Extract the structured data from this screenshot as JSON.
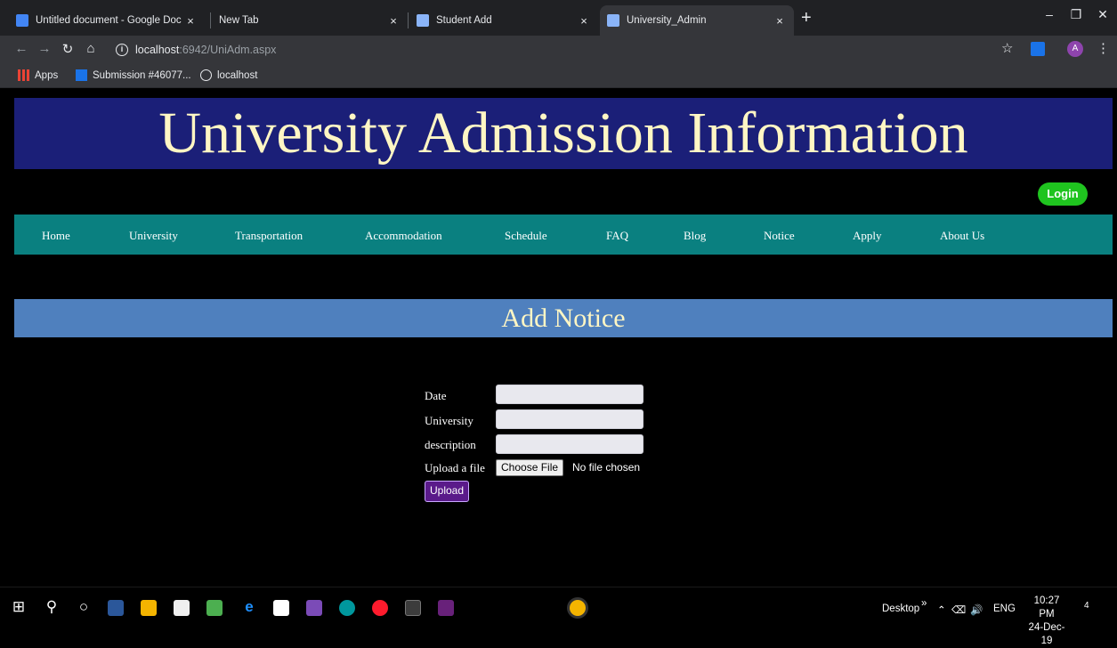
{
  "browser": {
    "tabs": [
      {
        "title": "Untitled document - Google Doc",
        "icon": "docs-icon",
        "color": "#4285f4"
      },
      {
        "title": "New Tab",
        "icon": "",
        "color": ""
      },
      {
        "title": "Student Add",
        "icon": "page-icon",
        "color": "#8ab4f8"
      },
      {
        "title": "University_Admin",
        "icon": "page-icon",
        "color": "#8ab4f8"
      }
    ],
    "new_tab": "+",
    "close_glyph": "×",
    "url_host": "localhost",
    "url_rest": ":6942/UniAdm.aspx",
    "bookmarks": [
      "Apps",
      "Submission #46077...",
      "localhost"
    ],
    "avatar_letter": "A"
  },
  "page": {
    "banner_title": "University Admission Information",
    "login_label": "Login",
    "nav": [
      "Home",
      "University",
      "Transportation",
      "Accommodation",
      "Schedule",
      "FAQ",
      "Blog",
      "Notice",
      "Apply",
      "About Us"
    ],
    "section_title": "Add Notice",
    "form": {
      "date_label": "Date",
      "university_label": "University",
      "description_label": "description",
      "upload_label": "Upload a file",
      "choose_file": "Choose File",
      "no_file": "No file chosen",
      "upload_button": "Upload"
    },
    "colors": {
      "banner_bg": "#1b1f78",
      "title_text": "#fff6c4",
      "nav_bg": "#0a8080",
      "section_bg": "#4f80be",
      "login_bg": "#1fc41f",
      "upload_bg": "#5a1a8a"
    }
  },
  "taskbar": {
    "desktop_label": "Desktop",
    "chevron": "»",
    "lang": "ENG",
    "time": "10:27 PM",
    "date": "24-Dec-19",
    "notifications": "4"
  }
}
